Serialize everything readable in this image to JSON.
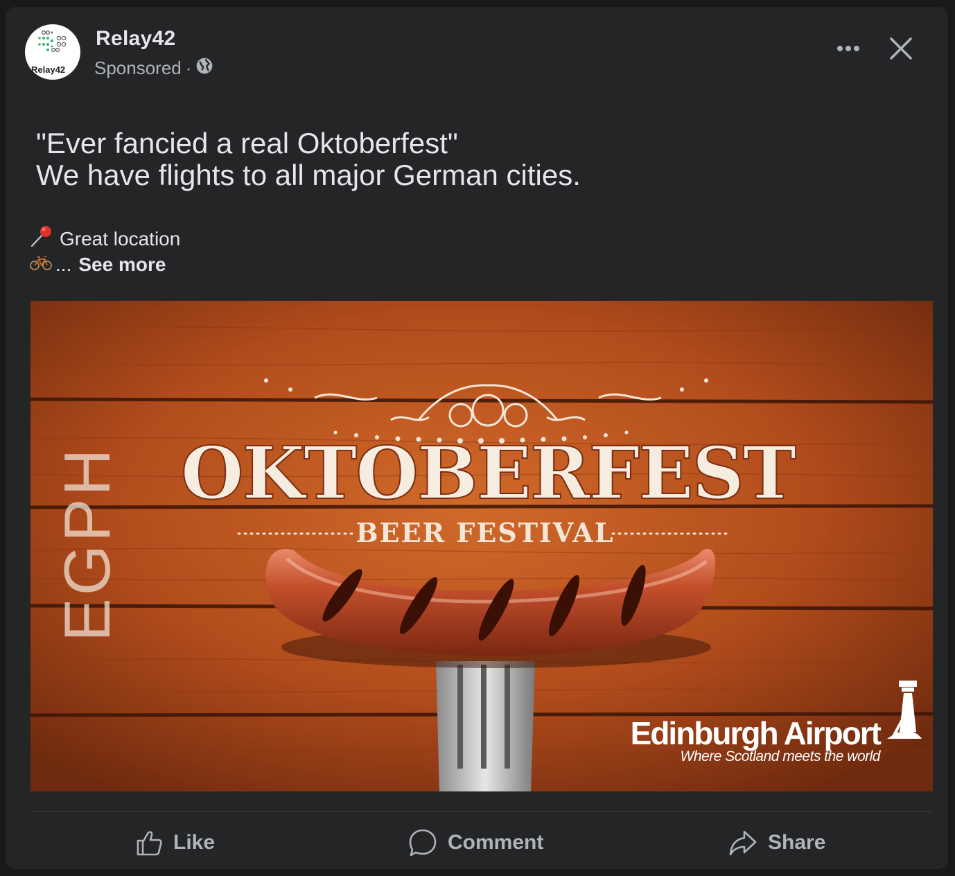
{
  "post": {
    "page_name": "Relay42",
    "sponsored": "Sponsored",
    "separator": "·",
    "headline_line1": "\"Ever fancied a real Oktoberfest\"",
    "headline_line2": "We have flights to all major German cities.",
    "detail_line1": "Great location",
    "detail_ellipsis": "...",
    "see_more": "See more"
  },
  "logo": {
    "text": "Relay42"
  },
  "ad_image": {
    "side_code": "EGPH",
    "title": "OKTOBERFEST",
    "subtitle": "BEER FESTIVAL",
    "brand": "Edinburgh Airport",
    "tagline": "Where Scotland meets the world"
  },
  "actions": {
    "like": "Like",
    "comment": "Comment",
    "share": "Share"
  },
  "icons": {
    "privacy": "globe-icon",
    "more": "more-dots-icon",
    "close": "close-icon",
    "pin": "pushpin-icon",
    "bike": "bicycle-icon"
  },
  "colors": {
    "background": "#18191a",
    "card": "#242526",
    "text_primary": "#e4e6eb",
    "text_secondary": "#b0b3b8",
    "wood": "#b5511e"
  }
}
